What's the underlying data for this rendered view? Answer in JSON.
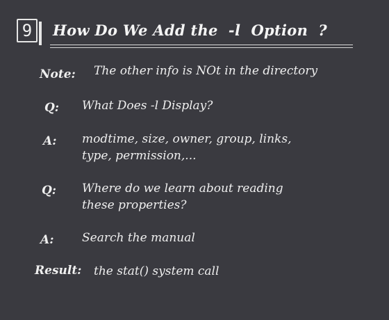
{
  "slide_number": "9",
  "title": "How Do We Add the  -l  Option  ?",
  "note": {
    "label": "Note:",
    "text": "The other info is NOt in the directory"
  },
  "qa": [
    {
      "label": "Q:",
      "text": "What Does  -l  Display?"
    },
    {
      "label": "A:",
      "line1": "modtime, size, owner, group, links,",
      "line2": "type, permission,..."
    },
    {
      "label": "Q:",
      "line1": "Where do we learn about reading",
      "line2": "these properties?"
    },
    {
      "label": "A:",
      "text": "Search the manual"
    }
  ],
  "result": {
    "label": "Result:",
    "text": "the stat() system call"
  }
}
